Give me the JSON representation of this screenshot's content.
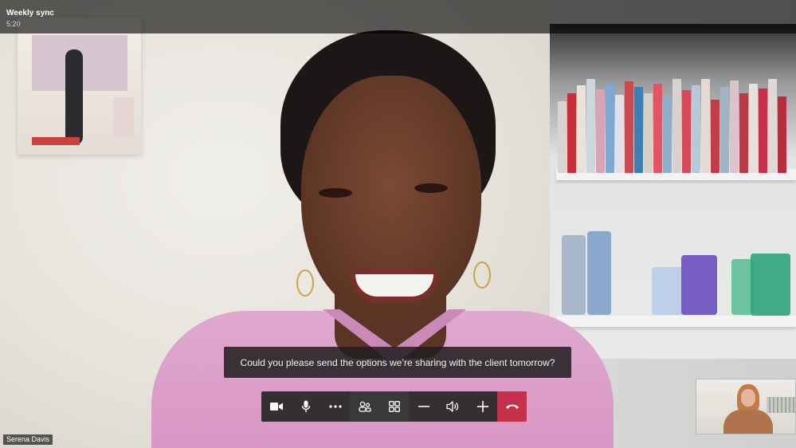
{
  "meeting": {
    "title": "Weekly sync",
    "duration": "5:20"
  },
  "caption": {
    "text": "Could you please send the options we’re sharing with the client tomorrow?"
  },
  "participant": {
    "name": "Serena Davis"
  },
  "controls": [
    {
      "name": "camera-button",
      "icon": "video-camera-icon"
    },
    {
      "name": "microphone-button",
      "icon": "microphone-icon"
    },
    {
      "name": "more-options-button",
      "icon": "ellipsis-icon"
    },
    {
      "name": "participants-button",
      "icon": "people-icon"
    },
    {
      "name": "layout-button",
      "icon": "grid-icon"
    },
    {
      "name": "zoom-out-button",
      "icon": "minus-icon"
    },
    {
      "name": "volume-button",
      "icon": "speaker-icon"
    },
    {
      "name": "zoom-in-button",
      "icon": "plus-icon"
    },
    {
      "name": "end-call-button",
      "icon": "hang-up-icon"
    }
  ],
  "colors": {
    "end_call": "#c4314b",
    "overlay": "#000000",
    "control_bar": "#262626"
  }
}
